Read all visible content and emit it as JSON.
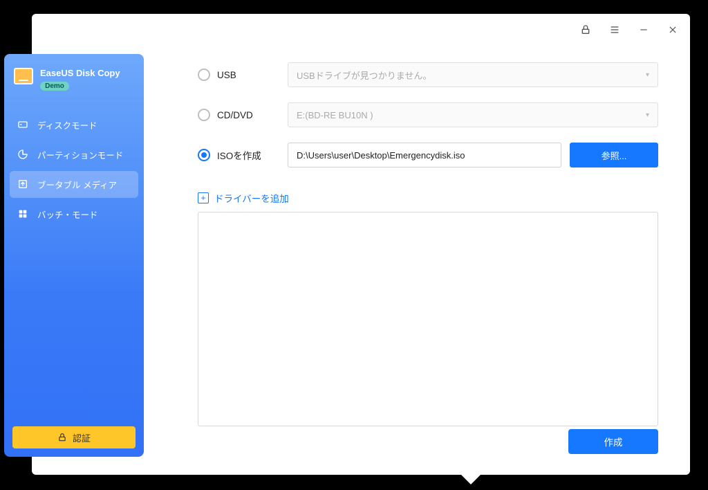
{
  "brand": {
    "title": "EaseUS Disk Copy",
    "badge": "Demo"
  },
  "nav": {
    "items": [
      {
        "label": "ディスクモード"
      },
      {
        "label": "パーティションモード"
      },
      {
        "label": "ブータブル メディア"
      },
      {
        "label": "バッチ・モード"
      }
    ]
  },
  "auth": {
    "label": "認証"
  },
  "options": {
    "usb": {
      "label": "USB",
      "placeholder": "USBドライブが見つかりません。"
    },
    "cddvd": {
      "label": "CD/DVD",
      "placeholder": "E:(BD-RE BU10N    )"
    },
    "iso": {
      "label": "ISOを作成",
      "value": "D:\\Users\\user\\Desktop\\Emergencydisk.iso"
    }
  },
  "buttons": {
    "browse": "参照...",
    "create": "作成"
  },
  "addDriver": {
    "label": "ドライバーを追加"
  }
}
